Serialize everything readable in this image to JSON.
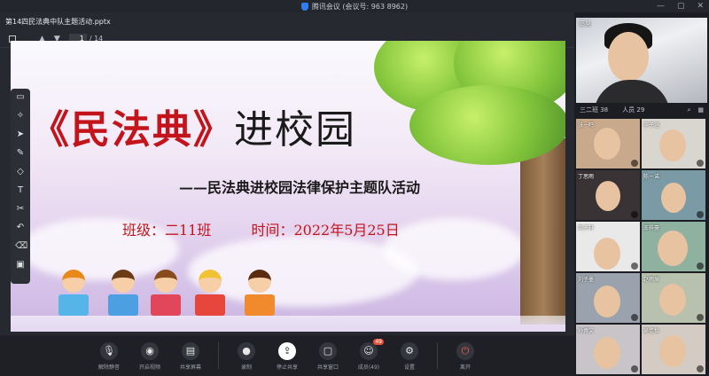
{
  "window": {
    "title": "腾讯会议 (会议号: 963 8962)"
  },
  "file": {
    "name": "第14四民法典中队主题活动.pptx"
  },
  "pdf_toolbar": {
    "page_current": "1",
    "page_total": "/ 14"
  },
  "slide": {
    "title_red": "《民法典》",
    "title_black": "进校园",
    "subtitle": "——民法典进校园法律保护主题队活动",
    "class_label": "班级：二11班",
    "time_label": "时间：2022年5月25日"
  },
  "bottom_toolbar": [
    {
      "label": "解除静音",
      "icon": "mic-icon"
    },
    {
      "label": "开启视频",
      "icon": "camera-icon"
    },
    {
      "label": "共享屏幕",
      "icon": "screen-icon"
    },
    {
      "label": "录制",
      "icon": "record-icon"
    },
    {
      "label": "停止共享",
      "icon": "share-icon",
      "active": true
    },
    {
      "label": "共享窗口",
      "icon": "window-icon"
    },
    {
      "label": "成员(49)",
      "icon": "members-icon",
      "badge": "49"
    },
    {
      "label": "设置",
      "icon": "gear-icon"
    },
    {
      "label": "离开",
      "icon": "hangup-icon"
    }
  ],
  "participants": {
    "main_name": "高昊",
    "header_left": "三二班 38",
    "header_mid": "人员 29",
    "tiles": [
      {
        "name": "张一鸣"
      },
      {
        "name": "李子涵"
      },
      {
        "name": "丁思雨"
      },
      {
        "name": "陈一诺"
      },
      {
        "name": "周子轩"
      },
      {
        "name": "王梓豪"
      },
      {
        "name": "刘子墨"
      },
      {
        "name": "赵雨辰"
      },
      {
        "name": "孙博文"
      },
      {
        "name": "吴佳怡"
      }
    ]
  }
}
